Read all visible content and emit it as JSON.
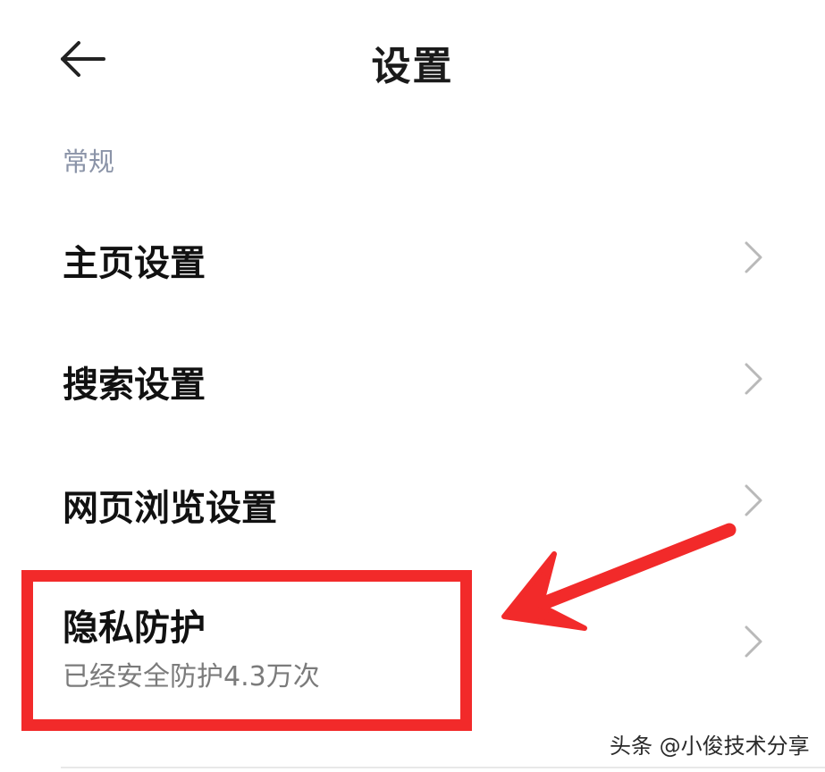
{
  "header": {
    "title": "设置",
    "back_icon": "arrow-left-icon"
  },
  "section": {
    "label": "常规"
  },
  "items": [
    {
      "label": "主页设置"
    },
    {
      "label": "搜索设置"
    },
    {
      "label": "网页浏览设置"
    },
    {
      "label": "隐私防护",
      "subtitle": "已经安全防护4.3万次"
    }
  ],
  "annotation": {
    "highlight_color": "#f22a2a",
    "arrow_color": "#f22a2a"
  },
  "watermark": {
    "text": "头条 @小俊技术分享"
  },
  "icons": {
    "chevron": "chevron-right-icon"
  }
}
